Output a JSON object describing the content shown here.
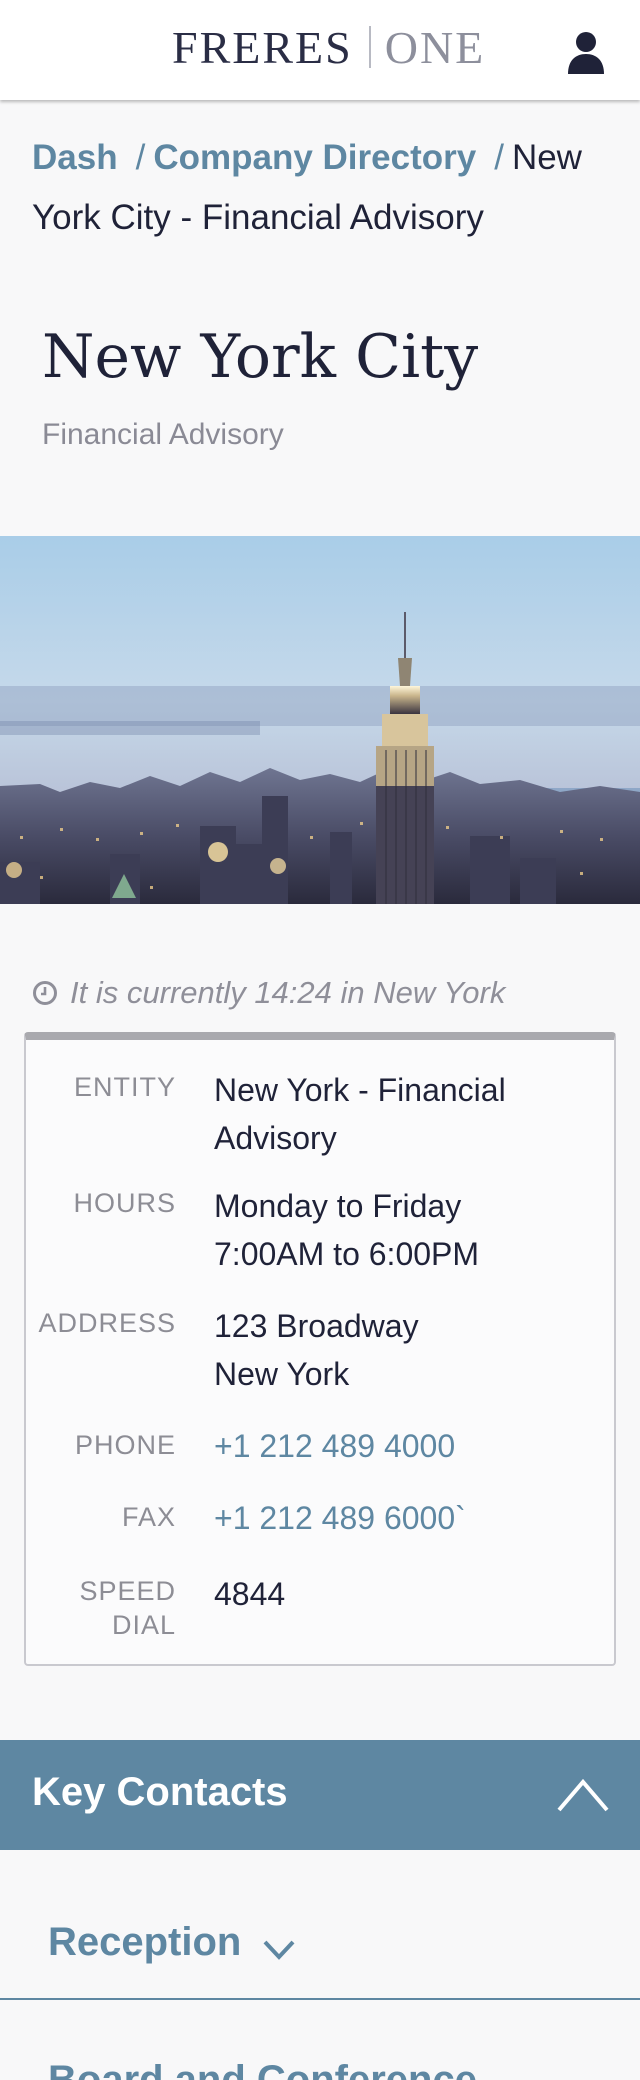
{
  "header": {
    "logo_left": "FRERES",
    "logo_right": "ONE",
    "user_icon": "user-icon"
  },
  "breadcrumb": {
    "items": [
      "Dash",
      "Company Directory"
    ],
    "separator": "/",
    "current": "New York City - Financial Advisory"
  },
  "page": {
    "title": "New York City",
    "subtitle": "Financial Advisory"
  },
  "hero": {
    "icon": "city-skyline-image"
  },
  "time": {
    "icon": "clock-icon",
    "text": "It is currently 14:24 in New York"
  },
  "info": {
    "entity_label": "ENTITY",
    "entity_value": "New York - Financial Advisory",
    "hours_label": "HOURS",
    "hours_line1": "Monday to Friday",
    "hours_line2": "7:00AM to 6:00PM",
    "address_label": "ADDRESS",
    "address_line1": "123 Broadway",
    "address_line2": "New York",
    "phone_label": "PHONE",
    "phone_value": "+1 212 489 4000",
    "fax_label": "FAX",
    "fax_value": "+1 212 489 6000`",
    "speed_label_line1": "SPEED",
    "speed_label_line2": "DIAL",
    "speed_value": "4844"
  },
  "key_contacts": {
    "title": "Key Contacts",
    "toggle_icon": "chevron-up-icon",
    "sections": [
      {
        "label": "Reception",
        "icon": "chevron-down-icon"
      },
      {
        "label": "Board and Conference"
      }
    ]
  },
  "colors": {
    "accent": "#5e87a2",
    "text": "#1f2238",
    "muted": "#8d8d95",
    "background": "#f8f8f9"
  }
}
